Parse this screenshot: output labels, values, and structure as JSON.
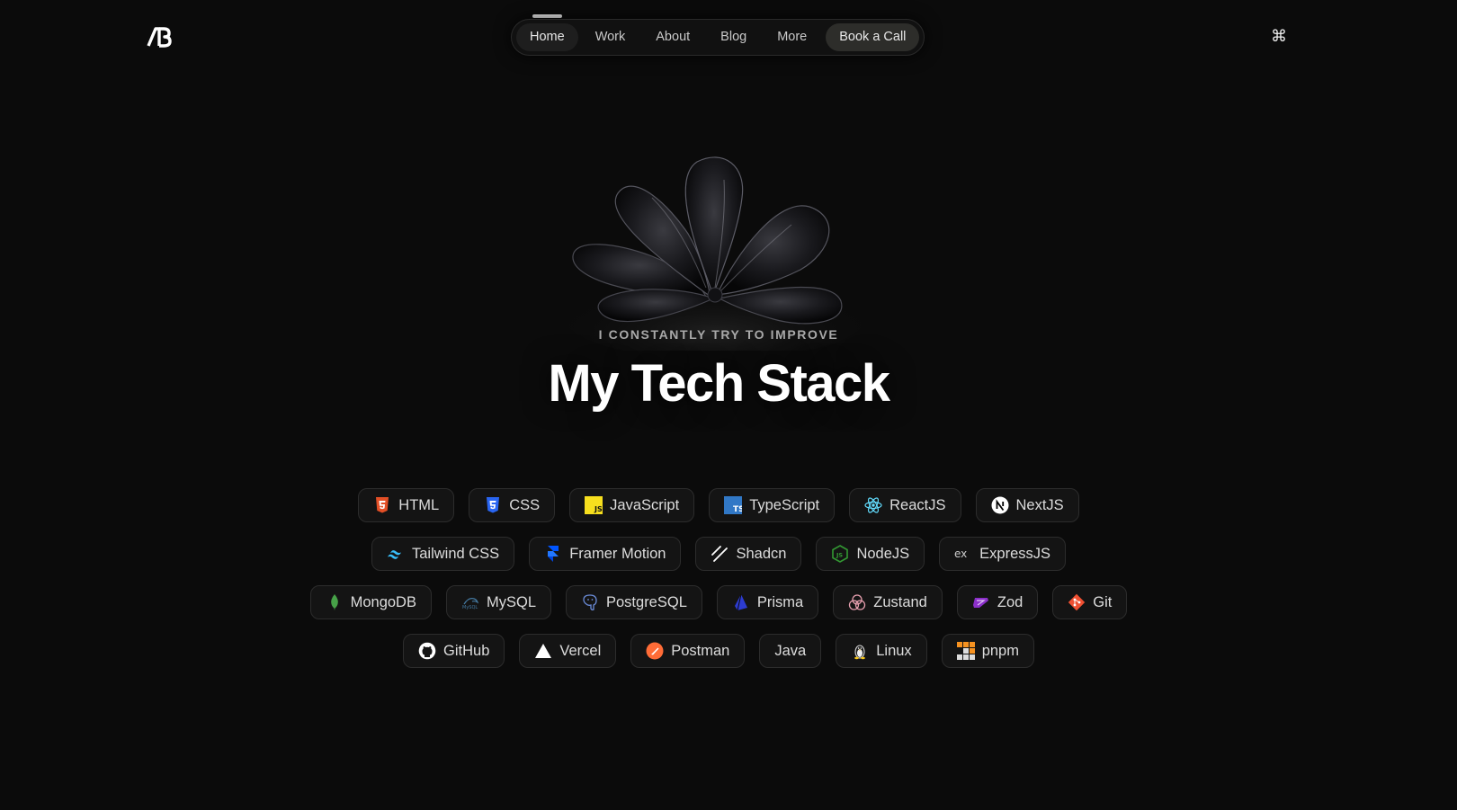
{
  "header": {
    "logo_text": "AB",
    "nav": [
      {
        "label": "Home",
        "active": true
      },
      {
        "label": "Work"
      },
      {
        "label": "About"
      },
      {
        "label": "Blog"
      },
      {
        "label": "More"
      }
    ],
    "cta_label": "Book a Call",
    "command_icon": "command-icon"
  },
  "hero": {
    "eyebrow": "I CONSTANTLY TRY TO IMPROVE",
    "title": "My Tech Stack"
  },
  "stack": {
    "row1": [
      {
        "label": "HTML",
        "icon": "html-icon",
        "color": "#e34f26"
      },
      {
        "label": "CSS",
        "icon": "css-icon",
        "color": "#2965f1"
      },
      {
        "label": "JavaScript",
        "icon": "javascript-icon",
        "color": "#f7df1e"
      },
      {
        "label": "TypeScript",
        "icon": "typescript-icon",
        "color": "#3178c6"
      },
      {
        "label": "ReactJS",
        "icon": "react-icon",
        "color": "#61dafb"
      },
      {
        "label": "NextJS",
        "icon": "nextjs-icon",
        "color": "#ffffff"
      }
    ],
    "row2": [
      {
        "label": "Tailwind CSS",
        "icon": "tailwind-icon",
        "color": "#38bdf8"
      },
      {
        "label": "Framer Motion",
        "icon": "framer-icon",
        "color": "#0055ff"
      },
      {
        "label": "Shadcn",
        "icon": "shadcn-icon",
        "color": "#ffffff"
      },
      {
        "label": "NodeJS",
        "icon": "nodejs-icon",
        "color": "#339933"
      },
      {
        "label": "ExpressJS",
        "icon": "express-icon",
        "color": "#cccccc"
      }
    ],
    "row3": [
      {
        "label": "MongoDB",
        "icon": "mongodb-icon",
        "color": "#47a248"
      },
      {
        "label": "MySQL",
        "icon": "mysql-icon",
        "color": "#4479a1"
      },
      {
        "label": "PostgreSQL",
        "icon": "postgresql-icon",
        "color": "#4169e1"
      },
      {
        "label": "Prisma",
        "icon": "prisma-icon",
        "color": "#2d3cd0"
      },
      {
        "label": "Zustand",
        "icon": "zustand-icon",
        "color": "#e8a0b0"
      },
      {
        "label": "Zod",
        "icon": "zod-icon",
        "color": "#8b2fc9"
      },
      {
        "label": "Git",
        "icon": "git-icon",
        "color": "#f05032"
      }
    ],
    "row4": [
      {
        "label": "GitHub",
        "icon": "github-icon",
        "color": "#ffffff"
      },
      {
        "label": "Vercel",
        "icon": "vercel-icon",
        "color": "#ffffff"
      },
      {
        "label": "Postman",
        "icon": "postman-icon",
        "color": "#ff6c37"
      },
      {
        "label": "Java",
        "icon": "",
        "color": ""
      },
      {
        "label": "Linux",
        "icon": "linux-icon",
        "color": "#f5c518"
      },
      {
        "label": "pnpm",
        "icon": "pnpm-icon",
        "color": "#f69220"
      }
    ]
  }
}
